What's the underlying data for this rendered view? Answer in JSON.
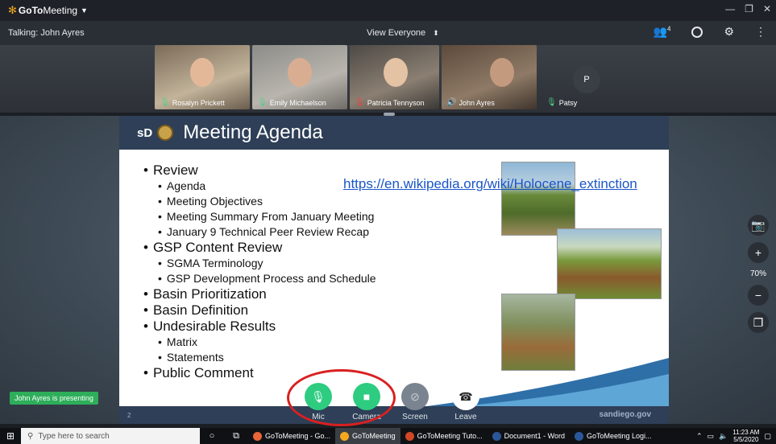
{
  "app": {
    "name_bold": "GoTo",
    "name_rest": "Meeting"
  },
  "status": {
    "talking": "Talking: John Ayres",
    "view": "View Everyone",
    "attendee_count": "4"
  },
  "participants": [
    {
      "name": "Rosalyn Prickett",
      "mic": "on"
    },
    {
      "name": "Emily Michaelson",
      "mic": "on"
    },
    {
      "name": "Patricia Tennyson",
      "mic": "muted"
    },
    {
      "name": "John Ayres",
      "mic": "speaking"
    },
    {
      "name": "Patsy",
      "mic": "on",
      "initial": "P"
    }
  ],
  "slide": {
    "logo_text": "sD",
    "title": "Meeting Agenda",
    "page": "2",
    "brand": "sandiego.gov",
    "link": "https://en.wikipedia.org/wiki/Holocene_extinction",
    "items": [
      {
        "level": 1,
        "text": "Review"
      },
      {
        "level": 2,
        "text": "Agenda"
      },
      {
        "level": 2,
        "text": "Meeting Objectives"
      },
      {
        "level": 2,
        "text": "Meeting Summary From January Meeting"
      },
      {
        "level": 2,
        "text": "January 9 Technical Peer Review Recap"
      },
      {
        "level": 1,
        "text": "GSP Content Review"
      },
      {
        "level": 2,
        "text": "SGMA Terminology"
      },
      {
        "level": 2,
        "text": "GSP Development Process and Schedule"
      },
      {
        "level": 1,
        "text": "Basin Prioritization"
      },
      {
        "level": 1,
        "text": "Basin Definition"
      },
      {
        "level": 1,
        "text": "Undesirable Results"
      },
      {
        "level": 2,
        "text": "Matrix"
      },
      {
        "level": 2,
        "text": "Statements"
      },
      {
        "level": 1,
        "text": "Public Comment"
      }
    ]
  },
  "zoom": "70%",
  "presenting": "John Ayres is presenting",
  "controls": {
    "mic": "Mic",
    "camera": "Camera",
    "screen": "Screen",
    "leave": "Leave"
  },
  "taskbar": {
    "search_placeholder": "Type here to search",
    "tasks": [
      {
        "label": "GoToMeeting - Go...",
        "color": "#e8663a"
      },
      {
        "label": "GoToMeeting",
        "color": "#f4a81d",
        "active": true
      },
      {
        "label": "GoToMeeting Tuto...",
        "color": "#d24726"
      },
      {
        "label": "Document1 - Word",
        "color": "#2b579a"
      },
      {
        "label": "GoToMeeting Logi...",
        "color": "#2b579a"
      }
    ],
    "time": "11:23 AM",
    "date": "5/5/2020"
  },
  "colors": {
    "accent_green": "#2ecc80",
    "highlight_red": "#d92020",
    "slide_navy": "#2e3f57"
  }
}
